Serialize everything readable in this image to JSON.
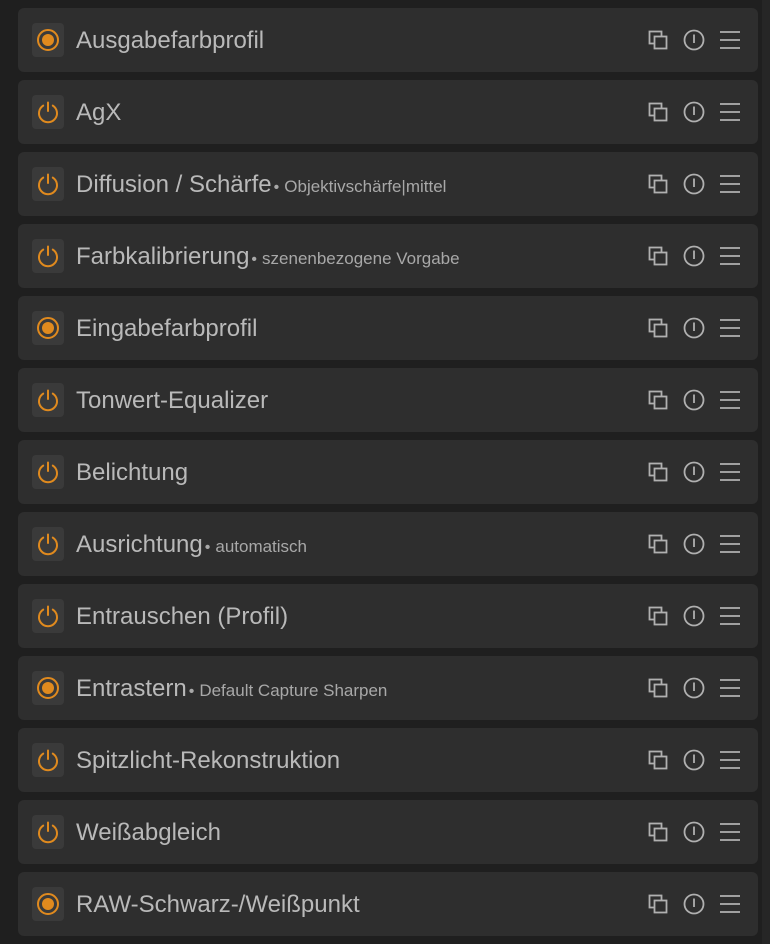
{
  "colors": {
    "accent": "#e08a1e",
    "text": "#b9b9b9",
    "panel_bg": "#1f1f1f",
    "row_bg": "#2e2e2e",
    "icon": "#b0b0b0"
  },
  "modules": [
    {
      "name": "Ausgabefarbprofil",
      "preset": "",
      "power_state": "always-on"
    },
    {
      "name": "AgX",
      "preset": "",
      "power_state": "toggle"
    },
    {
      "name": "Diffusion / Schärfe",
      "preset": "Objektivschärfe|mittel",
      "power_state": "toggle"
    },
    {
      "name": "Farbkalibrierung",
      "preset": "szenenbezogene Vorgabe",
      "power_state": "toggle"
    },
    {
      "name": "Eingabefarbprofil",
      "preset": "",
      "power_state": "always-on"
    },
    {
      "name": "Tonwert-Equalizer",
      "preset": "",
      "power_state": "toggle"
    },
    {
      "name": "Belichtung",
      "preset": "",
      "power_state": "toggle"
    },
    {
      "name": "Ausrichtung",
      "preset": "automatisch",
      "power_state": "toggle"
    },
    {
      "name": "Entrauschen (Profil)",
      "preset": "",
      "power_state": "toggle"
    },
    {
      "name": "Entrastern",
      "preset": "Default Capture Sharpen",
      "power_state": "always-on"
    },
    {
      "name": "Spitzlicht-Rekonstruktion",
      "preset": "",
      "power_state": "toggle"
    },
    {
      "name": "Weißabgleich",
      "preset": "",
      "power_state": "toggle"
    },
    {
      "name": "RAW-Schwarz-/Weißpunkt",
      "preset": "",
      "power_state": "always-on"
    }
  ],
  "separator": "•",
  "icons": {
    "power_toggle": "power-icon",
    "power_always_on": "always-on-icon",
    "multi_instance": "multi-instance-icon",
    "reset": "reset-icon",
    "presets": "presets-menu-icon"
  }
}
